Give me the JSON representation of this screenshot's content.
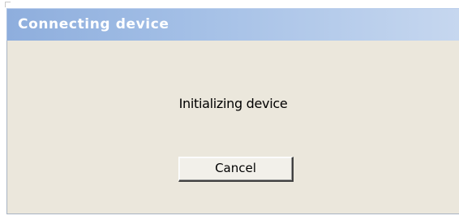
{
  "window": {
    "title": "Connecting device"
  },
  "dialog": {
    "message": "Initializing device",
    "cancel_label": "Cancel"
  },
  "colors": {
    "titlebar_start": "#8eaedd",
    "titlebar_end": "#c6d7ef",
    "client_background": "#ebe7dc"
  }
}
